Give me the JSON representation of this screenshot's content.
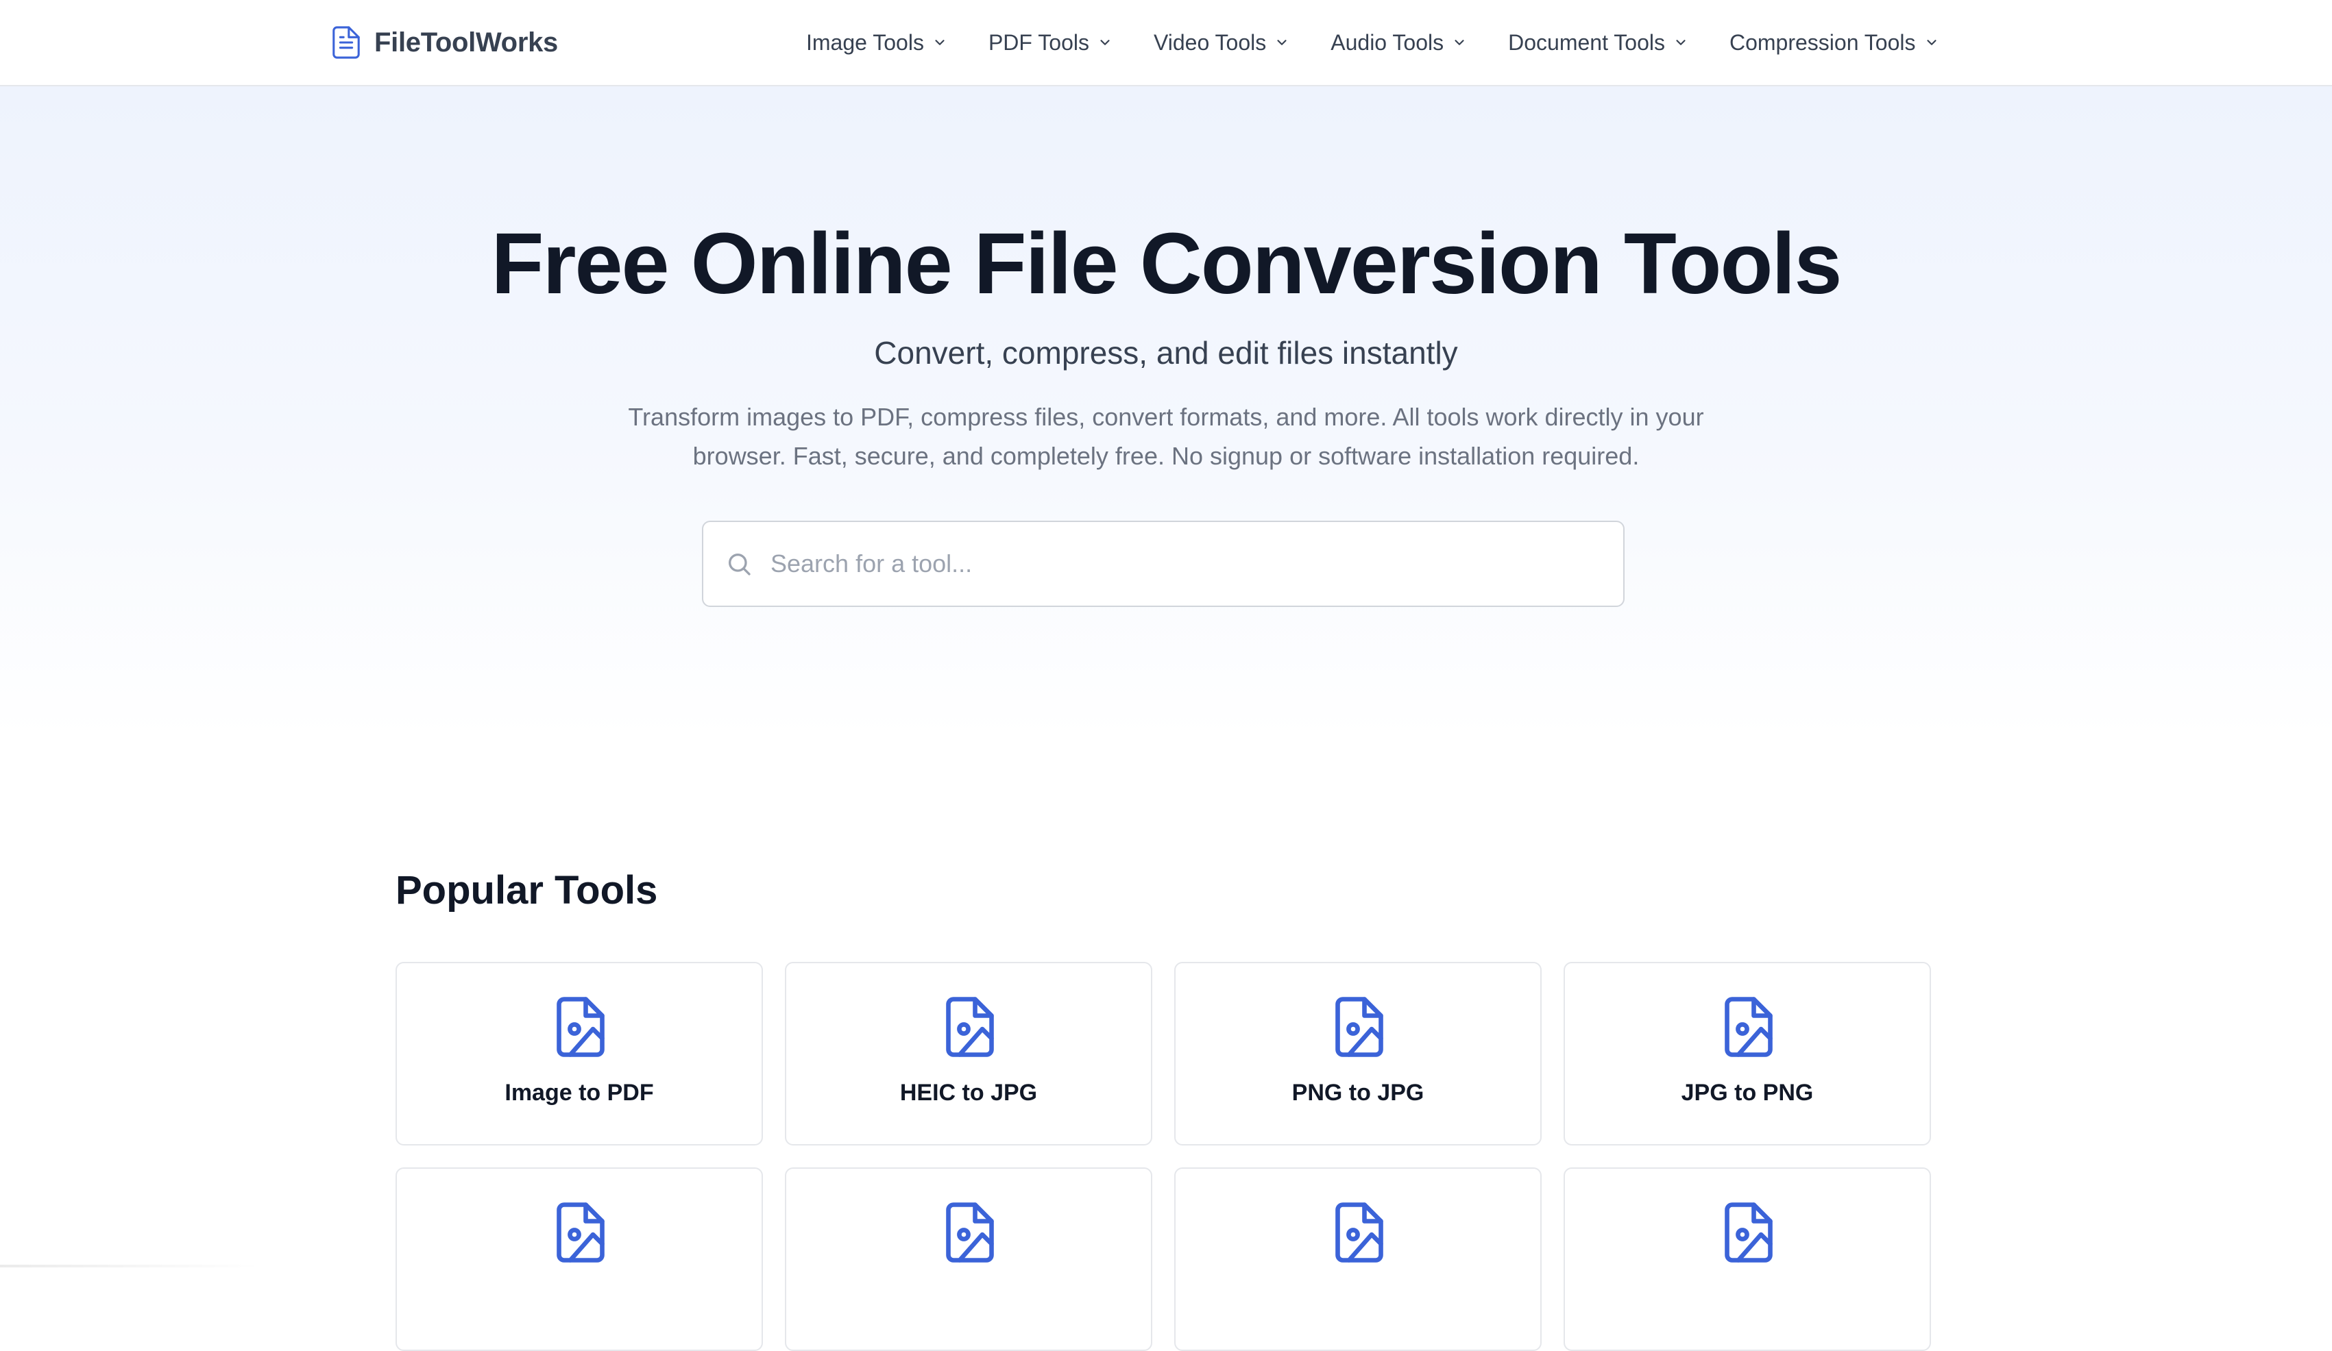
{
  "header": {
    "logo_text": "FileToolWorks",
    "logo_icon": "document-icon",
    "nav": [
      {
        "label": "Image Tools"
      },
      {
        "label": "PDF Tools"
      },
      {
        "label": "Video Tools"
      },
      {
        "label": "Audio Tools"
      },
      {
        "label": "Document Tools"
      },
      {
        "label": "Compression Tools"
      }
    ]
  },
  "hero": {
    "title": "Free Online File Conversion Tools",
    "subtitle": "Convert, compress, and edit files instantly",
    "description": "Transform images to PDF, compress files, convert formats, and more. All tools work directly in your browser. Fast, secure, and completely free. No signup or software installation required.",
    "search": {
      "placeholder": "Search for a tool...",
      "value": ""
    }
  },
  "popular": {
    "title": "Popular Tools",
    "tools": [
      {
        "label": "Image to PDF",
        "icon": "file-image-icon"
      },
      {
        "label": "HEIC to JPG",
        "icon": "file-image-icon"
      },
      {
        "label": "PNG to JPG",
        "icon": "file-image-icon"
      },
      {
        "label": "JPG to PNG",
        "icon": "file-image-icon"
      },
      {
        "label": "",
        "icon": "file-image-icon"
      },
      {
        "label": "",
        "icon": "file-image-icon"
      },
      {
        "label": "",
        "icon": "file-image-icon"
      },
      {
        "label": "",
        "icon": "file-image-icon"
      }
    ]
  },
  "colors": {
    "accent": "#3b63d8",
    "text_dark": "#111827",
    "text_muted": "#6b7280",
    "border": "#e5e7eb",
    "hero_bg": "#eef3fd"
  }
}
